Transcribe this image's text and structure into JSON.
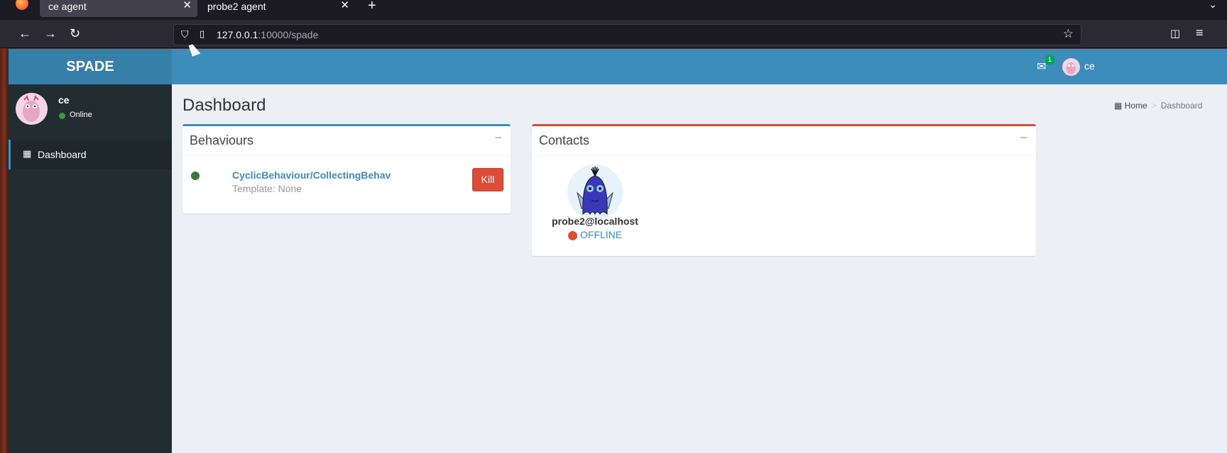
{
  "browser": {
    "tabs": [
      {
        "label": "ce agent",
        "active": true
      },
      {
        "label": "probe2 agent",
        "active": false
      }
    ],
    "url_host": "127.0.0.1",
    "url_rest": ":10000/spade",
    "icons": [
      "firefox-logo",
      "back-icon",
      "forward-icon",
      "reload-icon",
      "shield-icon",
      "page-icon",
      "star-icon",
      "pocket-icon",
      "menu-icon"
    ]
  },
  "sidebar": {
    "logo": "SPADE",
    "user": {
      "name": "ce",
      "status": "Online"
    },
    "items": [
      {
        "label": "Dashboard",
        "icon": "dashboard-icon"
      }
    ]
  },
  "header": {
    "mail_count": "1",
    "user_name": "ce"
  },
  "page": {
    "title": "Dashboard",
    "breadcrumb": {
      "home": "Home",
      "current": "Dashboard"
    }
  },
  "behaviours": {
    "title": "Behaviours",
    "collapse": "−",
    "items": [
      {
        "name": "CyclicBehaviour/CollectingBehav",
        "template": "Template: None",
        "status_color": "#3b7a3b",
        "action": "Kill"
      }
    ]
  },
  "contacts": {
    "title": "Contacts",
    "collapse": "−",
    "items": [
      {
        "jid": "probe2@localhost",
        "status": "OFFLINE",
        "status_color": "#dd4b39"
      }
    ]
  },
  "colors": {
    "header": "#3c8dbc",
    "logo": "#367fa9",
    "sidebar": "#222d32",
    "primary": "#3c8dbc",
    "danger": "#dd4b39"
  }
}
